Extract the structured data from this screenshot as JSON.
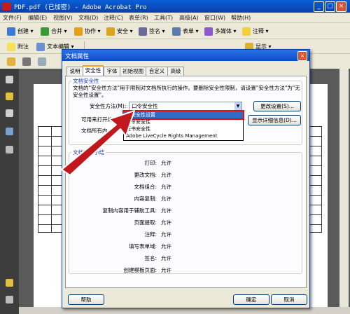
{
  "window": {
    "title": "PDF.pdf  (已加密) - Adobe Acrobat Pro"
  },
  "menu": [
    "文件(F)",
    "编辑(E)",
    "视图(V)",
    "文档(D)",
    "注释(C)",
    "表单(R)",
    "工具(T)",
    "高级(A)",
    "窗口(W)",
    "帮助(H)"
  ],
  "toolbar1": [
    "创建",
    "合并",
    "协作",
    "安全",
    "签名",
    "表单",
    "多媒体",
    "注释"
  ],
  "toolbar2": [
    "附注",
    "文本编辑",
    "显示"
  ],
  "dialog": {
    "title": "文档属性",
    "tabs": [
      "说明",
      "安全性",
      "字体",
      "初始视图",
      "自定义",
      "高级"
    ],
    "active_tab": "安全性",
    "security_group_title": "文档安全性",
    "security_desc": "文档的\"安全性方法\"用于限制对文档所执行的操作。要删除安全性限制，请设置\"安全性方法\"为\"无安全性设置\"。",
    "method_label": "安全性方法(M):",
    "method_value": "口令安全性",
    "change_settings_btn": "更改设置(S)...",
    "open_with_label": "可用来打开的程序",
    "details_btn": "显示详细信息(D)...",
    "all_content_label": "文档所有内",
    "restrictions_title": "文档限制小结",
    "restrictions": [
      {
        "label": "打印:",
        "value": "允许"
      },
      {
        "label": "更改文档:",
        "value": "允许"
      },
      {
        "label": "文档组合:",
        "value": "允许"
      },
      {
        "label": "内容复制:",
        "value": "允许"
      },
      {
        "label": "复制内容用于辅助工具:",
        "value": "允许"
      },
      {
        "label": "页面提取:",
        "value": "允许"
      },
      {
        "label": "注释:",
        "value": "允许"
      },
      {
        "label": "填写表单域:",
        "value": "允许"
      },
      {
        "label": "签名:",
        "value": "允许"
      },
      {
        "label": "创建模板页面:",
        "value": "允许"
      }
    ],
    "dropdown_options": [
      "无安全性设置",
      "口令安全性",
      "证书安全性",
      "Adobe LiveCycle Rights Management"
    ],
    "selected_option": "无安全性设置",
    "help_btn": "帮助",
    "ok_btn": "确定",
    "cancel_btn": "取消"
  },
  "colors": {
    "highlight_outline": "#e01010",
    "arrow": "#c0181c",
    "selection": "#316ac5"
  }
}
